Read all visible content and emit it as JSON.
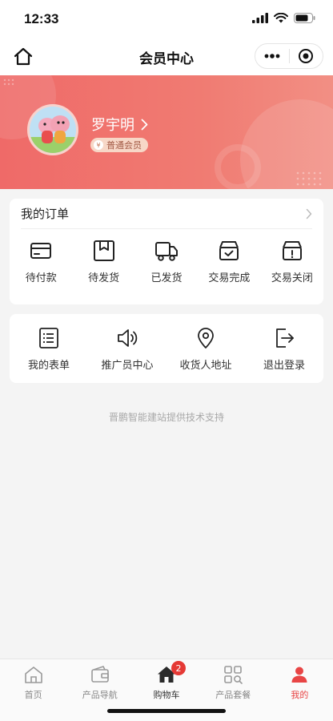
{
  "status_bar": {
    "time": "12:33"
  },
  "nav": {
    "title": "会员中心"
  },
  "profile": {
    "name": "罗宇明",
    "member_level": "普通会员",
    "badge_symbol": "¥"
  },
  "orders": {
    "title": "我的订单",
    "items": [
      {
        "label": "待付款",
        "icon": "card-icon"
      },
      {
        "label": "待发货",
        "icon": "package-icon"
      },
      {
        "label": "已发货",
        "icon": "truck-icon"
      },
      {
        "label": "交易完成",
        "icon": "box-check-icon"
      },
      {
        "label": "交易关闭",
        "icon": "box-alert-icon"
      }
    ]
  },
  "tools": {
    "items": [
      {
        "label": "我的表单",
        "icon": "form-list-icon"
      },
      {
        "label": "推广员中心",
        "icon": "speaker-icon"
      },
      {
        "label": "收货人地址",
        "icon": "location-pin-icon"
      },
      {
        "label": "退出登录",
        "icon": "logout-icon"
      }
    ]
  },
  "footer_note": "晋鹏智能建站提供技术支持",
  "tab_bar": {
    "items": [
      {
        "label": "首页",
        "icon": "home-icon"
      },
      {
        "label": "产品导航",
        "icon": "wallet-icon"
      },
      {
        "label": "购物车",
        "icon": "home-filled-icon",
        "badge": "2"
      },
      {
        "label": "产品套餐",
        "icon": "grid-search-icon"
      },
      {
        "label": "我的",
        "icon": "user-icon",
        "active": true
      }
    ]
  },
  "colors": {
    "accent": "#e84545",
    "banner_start": "#ef6a68",
    "banner_end": "#f28f84",
    "badge": "#e53935"
  }
}
